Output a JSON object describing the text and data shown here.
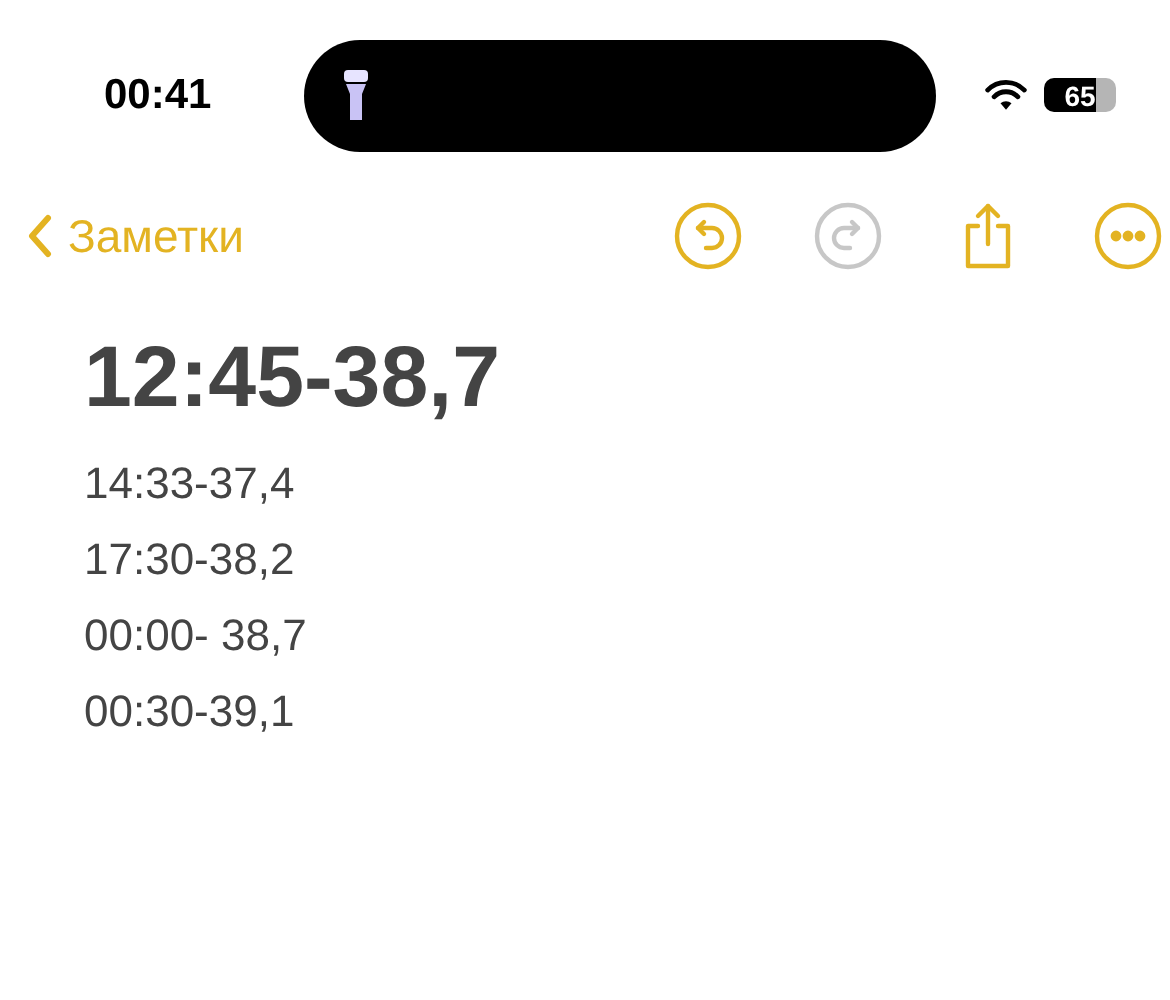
{
  "status_bar": {
    "time": "00:41",
    "battery": "65"
  },
  "nav": {
    "back_label": "Заметки",
    "actions": [
      {
        "kind": "undo",
        "disabled": false
      },
      {
        "kind": "redo",
        "disabled": true
      },
      {
        "kind": "share",
        "disabled": false
      },
      {
        "kind": "more",
        "disabled": false
      }
    ]
  },
  "note": {
    "title": "12:45-38,7",
    "lines": [
      "14:33-37,4",
      "17:30-38,2",
      "00:00- 38,7",
      "00:30-39,1"
    ]
  }
}
